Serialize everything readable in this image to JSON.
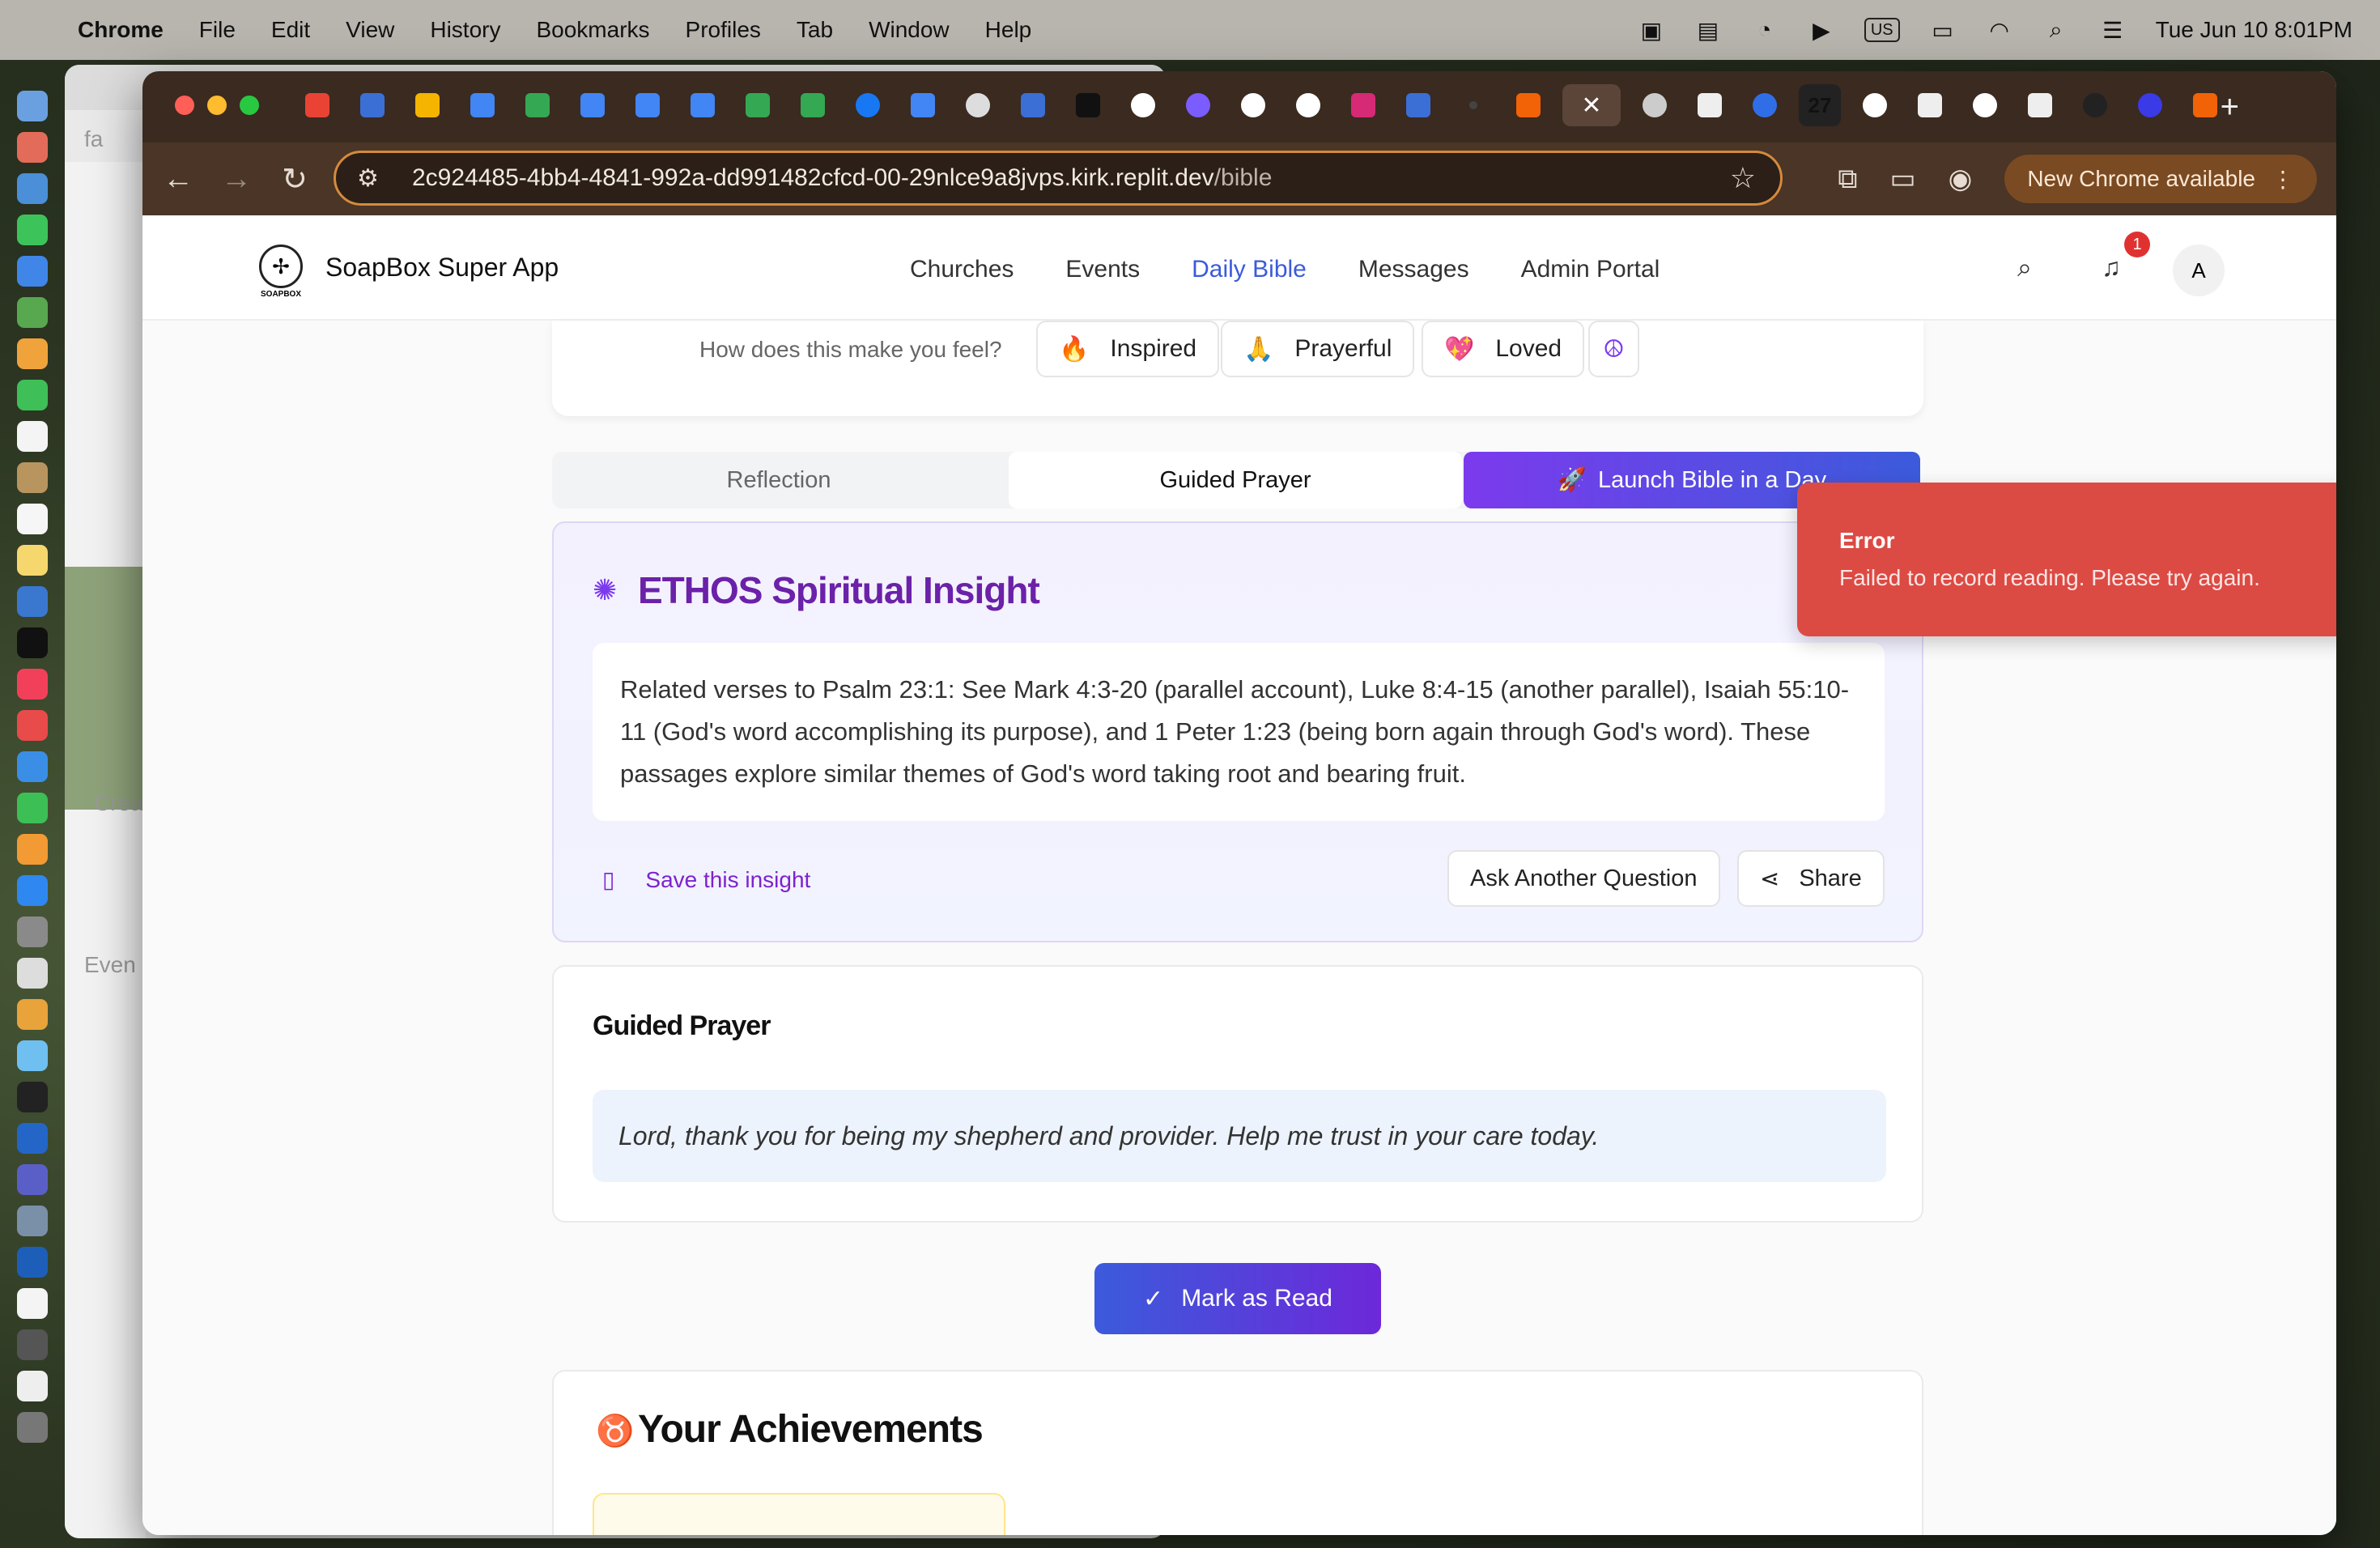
{
  "menubar": {
    "app": "Chrome",
    "items": [
      "File",
      "Edit",
      "View",
      "History",
      "Bookmarks",
      "Profiles",
      "Tab",
      "Window",
      "Help"
    ],
    "input_source": "US",
    "clock": "Tue Jun 10  8:01PM"
  },
  "browser": {
    "url_host": "2c924485-4bb4-4841-992a-dd991482cfcd-00-29nlce9a8jvps.kirk.replit.dev",
    "url_path": "/bible",
    "update_label": "New Chrome available",
    "tab_counter": "27"
  },
  "app": {
    "name": "SoapBox Super App",
    "logo_sub": "SOAPBOX",
    "nav": [
      "Churches",
      "Events",
      "Daily Bible",
      "Messages",
      "Admin Portal"
    ],
    "active_nav": "Daily Bible",
    "notification_count": "1",
    "avatar_initial": "A"
  },
  "feelings": {
    "question": "How does this make you feel?",
    "options": [
      {
        "emoji": "🔥",
        "label": "Inspired"
      },
      {
        "emoji": "🙏",
        "label": "Prayerful"
      },
      {
        "emoji": "💖",
        "label": "Loved"
      },
      {
        "emoji": "☮",
        "label": ""
      }
    ]
  },
  "tabs": {
    "reflection": "Reflection",
    "guided_prayer": "Guided Prayer",
    "launch": "Launch Bible in a Day"
  },
  "ethos": {
    "title": "ETHOS Spiritual Insight",
    "body": "Related verses to Psalm 23:1: See Mark 4:3-20 (parallel account), Luke 8:4-15 (another parallel), Isaiah 55:10-11 (God's word accomplishing its purpose), and 1 Peter 1:23 (being born again through God's word). These passages explore similar themes of God's word taking root and bearing fruit.",
    "save": "Save this insight",
    "ask": "Ask Another Question",
    "share": "Share"
  },
  "prayer": {
    "title": "Guided Prayer",
    "text": "Lord, thank you for being my shepherd and provider. Help me trust in your care today."
  },
  "mark_read": "Mark as Read",
  "achievements": {
    "title": "Your Achievements"
  },
  "toast": {
    "title": "Error",
    "message": "Failed to record reading. Please try again."
  },
  "background_window": {
    "text_a": "Crea",
    "text_b": "Even",
    "text_c": "fa"
  },
  "colors": {
    "accent_blue": "#3b5bdb",
    "accent_purple": "#7c3aed",
    "error_red": "#dc4a44",
    "omnibox_focus": "#d58a3c"
  }
}
